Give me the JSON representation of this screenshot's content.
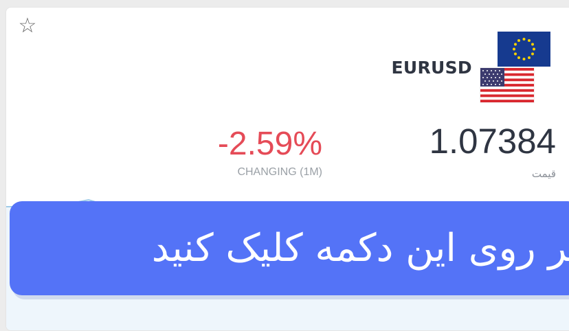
{
  "pair": {
    "name": "EURUSD"
  },
  "price": {
    "value": "1.07384",
    "label": "قیمت"
  },
  "change": {
    "value": "-2.59%",
    "label": "CHANGING (1M)"
  },
  "banner": {
    "text": "بر روی این دکمه کلیک کنید"
  },
  "colors": {
    "banner": "#5473f7",
    "negative": "#e54b57",
    "text": "#2f3542"
  }
}
